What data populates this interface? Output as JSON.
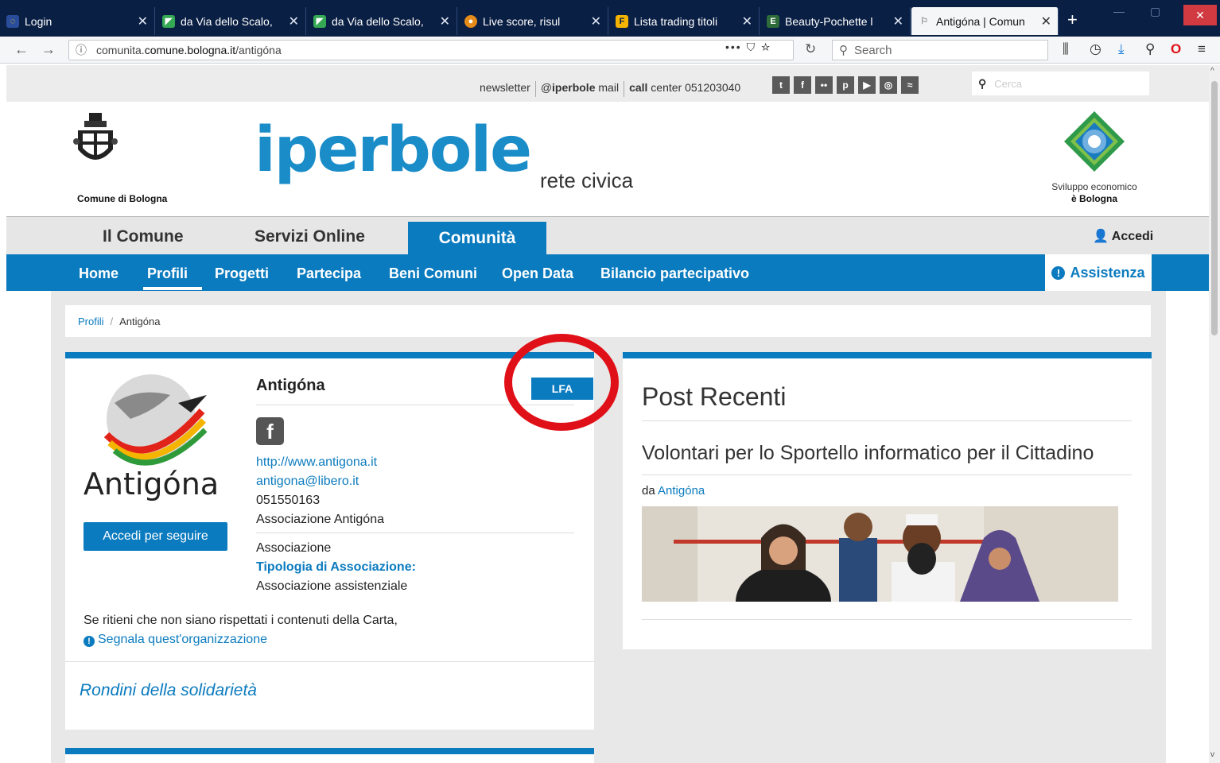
{
  "browser": {
    "tabs": [
      {
        "title": "Login",
        "favicon": "globe-icon"
      },
      {
        "title": "da Via dello Scalo,",
        "favicon": "maps-icon"
      },
      {
        "title": "da Via dello Scalo,",
        "favicon": "maps-icon"
      },
      {
        "title": "Live score, risul",
        "favicon": "score-icon"
      },
      {
        "title": "Lista trading titoli",
        "favicon": "f-icon"
      },
      {
        "title": "Beauty-Pochette l",
        "favicon": "e-icon"
      },
      {
        "title": "Antigóna | Comun",
        "favicon": "page-icon"
      }
    ],
    "url_prefix": "comunita.",
    "url_domain": "comune.bologna.it",
    "url_path": "/antigóna",
    "url_actions": "••• ",
    "search_placeholder": "Search",
    "colors": {
      "tabbar": "#0a1f44",
      "close": "#d03a40"
    }
  },
  "site": {
    "utility": {
      "newsletter": "newsletter",
      "mail_prefix": "@",
      "mail_bold": "iperbole",
      "mail_suffix": " mail",
      "call_bold": "call",
      "call_rest": " center 051203040",
      "social": [
        "twitter-icon",
        "facebook-icon",
        "flickr-icon",
        "pinterest-icon",
        "youtube-icon",
        "instagram-icon",
        "rss-icon"
      ],
      "social_glyphs": [
        "t",
        "f",
        "••",
        "p",
        "▶",
        "◎",
        "≈"
      ],
      "search_placeholder": "Cerca"
    },
    "header": {
      "crest_label": "Comune di Bologna",
      "brand": "iperbole",
      "brand_sub": "rete civica",
      "sviluppo_line1": "Sviluppo economico",
      "sviluppo_line2": "è Bologna"
    },
    "main_menu": [
      "Il Comune",
      "Servizi Online",
      "Comunità"
    ],
    "accedi": "Accedi",
    "sub_menu": [
      "Home",
      "Profili",
      "Progetti",
      "Partecipa",
      "Beni Comuni",
      "Open Data",
      "Bilancio partecipativo"
    ],
    "assistenza": "Assistenza",
    "breadcrumb": {
      "root": "Profili",
      "sep": "/",
      "current": "Antigóna"
    },
    "colors": {
      "primary": "#0b7bbf",
      "highlight_ring": "#e01018"
    }
  },
  "profile": {
    "logo_text": "Antigóna",
    "follow": "Accedi per seguire",
    "name": "Antigóna",
    "badge": "LFA",
    "website": "http://www.antigona.it",
    "email": "antigona@libero.it",
    "phone": "051550163",
    "full_name": "Associazione Antigóna",
    "type": "Associazione",
    "category_label": "Tipologia di Associazione:",
    "category_value": "Associazione assistenziale",
    "report_text": "Se ritieni che non siano rispettati i contenuti della Carta,",
    "report_link": "Segnala quest'organizzazione",
    "project": "Rondini della solidarietà"
  },
  "posts": {
    "title": "Post Recenti",
    "items": [
      {
        "heading": "Volontari per lo Sportello informatico per il Cittadino",
        "by": "da",
        "author": "Antigóna"
      }
    ]
  }
}
